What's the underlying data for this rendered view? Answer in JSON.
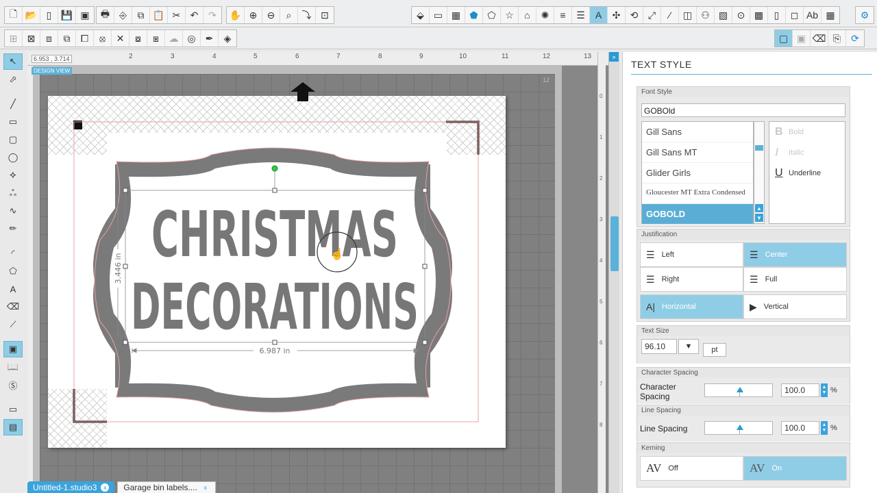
{
  "ruler": {
    "coords": "6.953 , 3.714",
    "design_view": "DESIGN VIEW",
    "top_numbers": [
      "2",
      "3",
      "4",
      "5",
      "6",
      "7",
      "8",
      "9",
      "10",
      "11",
      "12",
      "13"
    ],
    "right_numbers": [
      "0",
      "1",
      "2",
      "3",
      "4",
      "5",
      "6",
      "7",
      "8"
    ]
  },
  "design": {
    "line1": "CHRISTMAS",
    "line2": "DECORATIONS",
    "width_label": "6.987 in",
    "height_label": "3.446 in",
    "mat_number": "12"
  },
  "tabs": [
    {
      "label": "Untitled-1.studio3",
      "close": "x"
    },
    {
      "label": "Garage bin labels....",
      "close": "x"
    }
  ],
  "panel": {
    "title": "TEXT STYLE",
    "font_style": {
      "heading": "Font Style",
      "value": "GOBOld",
      "fonts": [
        "Gill Sans",
        "Gill Sans MT",
        "Glider Girls",
        "Gloucester MT Extra Condensed",
        "GOBOLD"
      ],
      "styles": [
        {
          "glyph": "B",
          "label": "Bold"
        },
        {
          "glyph": "I",
          "label": "Italic"
        },
        {
          "glyph": "U",
          "label": "Underline"
        }
      ]
    },
    "justification": {
      "heading": "Justification",
      "left": "Left",
      "center": "Center",
      "right": "Right",
      "full": "Full",
      "horizontal": "Horizontal",
      "vertical": "Vertical"
    },
    "text_size": {
      "heading": "Text Size",
      "value": "96.10",
      "unit": "pt"
    },
    "character_spacing": {
      "heading": "Character Spacing",
      "label": "Character Spacing",
      "value": "100.0",
      "pct": "%"
    },
    "line_spacing": {
      "heading": "Line Spacing",
      "label": "Line Spacing",
      "value": "100.0",
      "pct": "%"
    },
    "kerning": {
      "heading": "Kerning",
      "off": "Off",
      "on": "On",
      "glyph": "AV"
    }
  }
}
